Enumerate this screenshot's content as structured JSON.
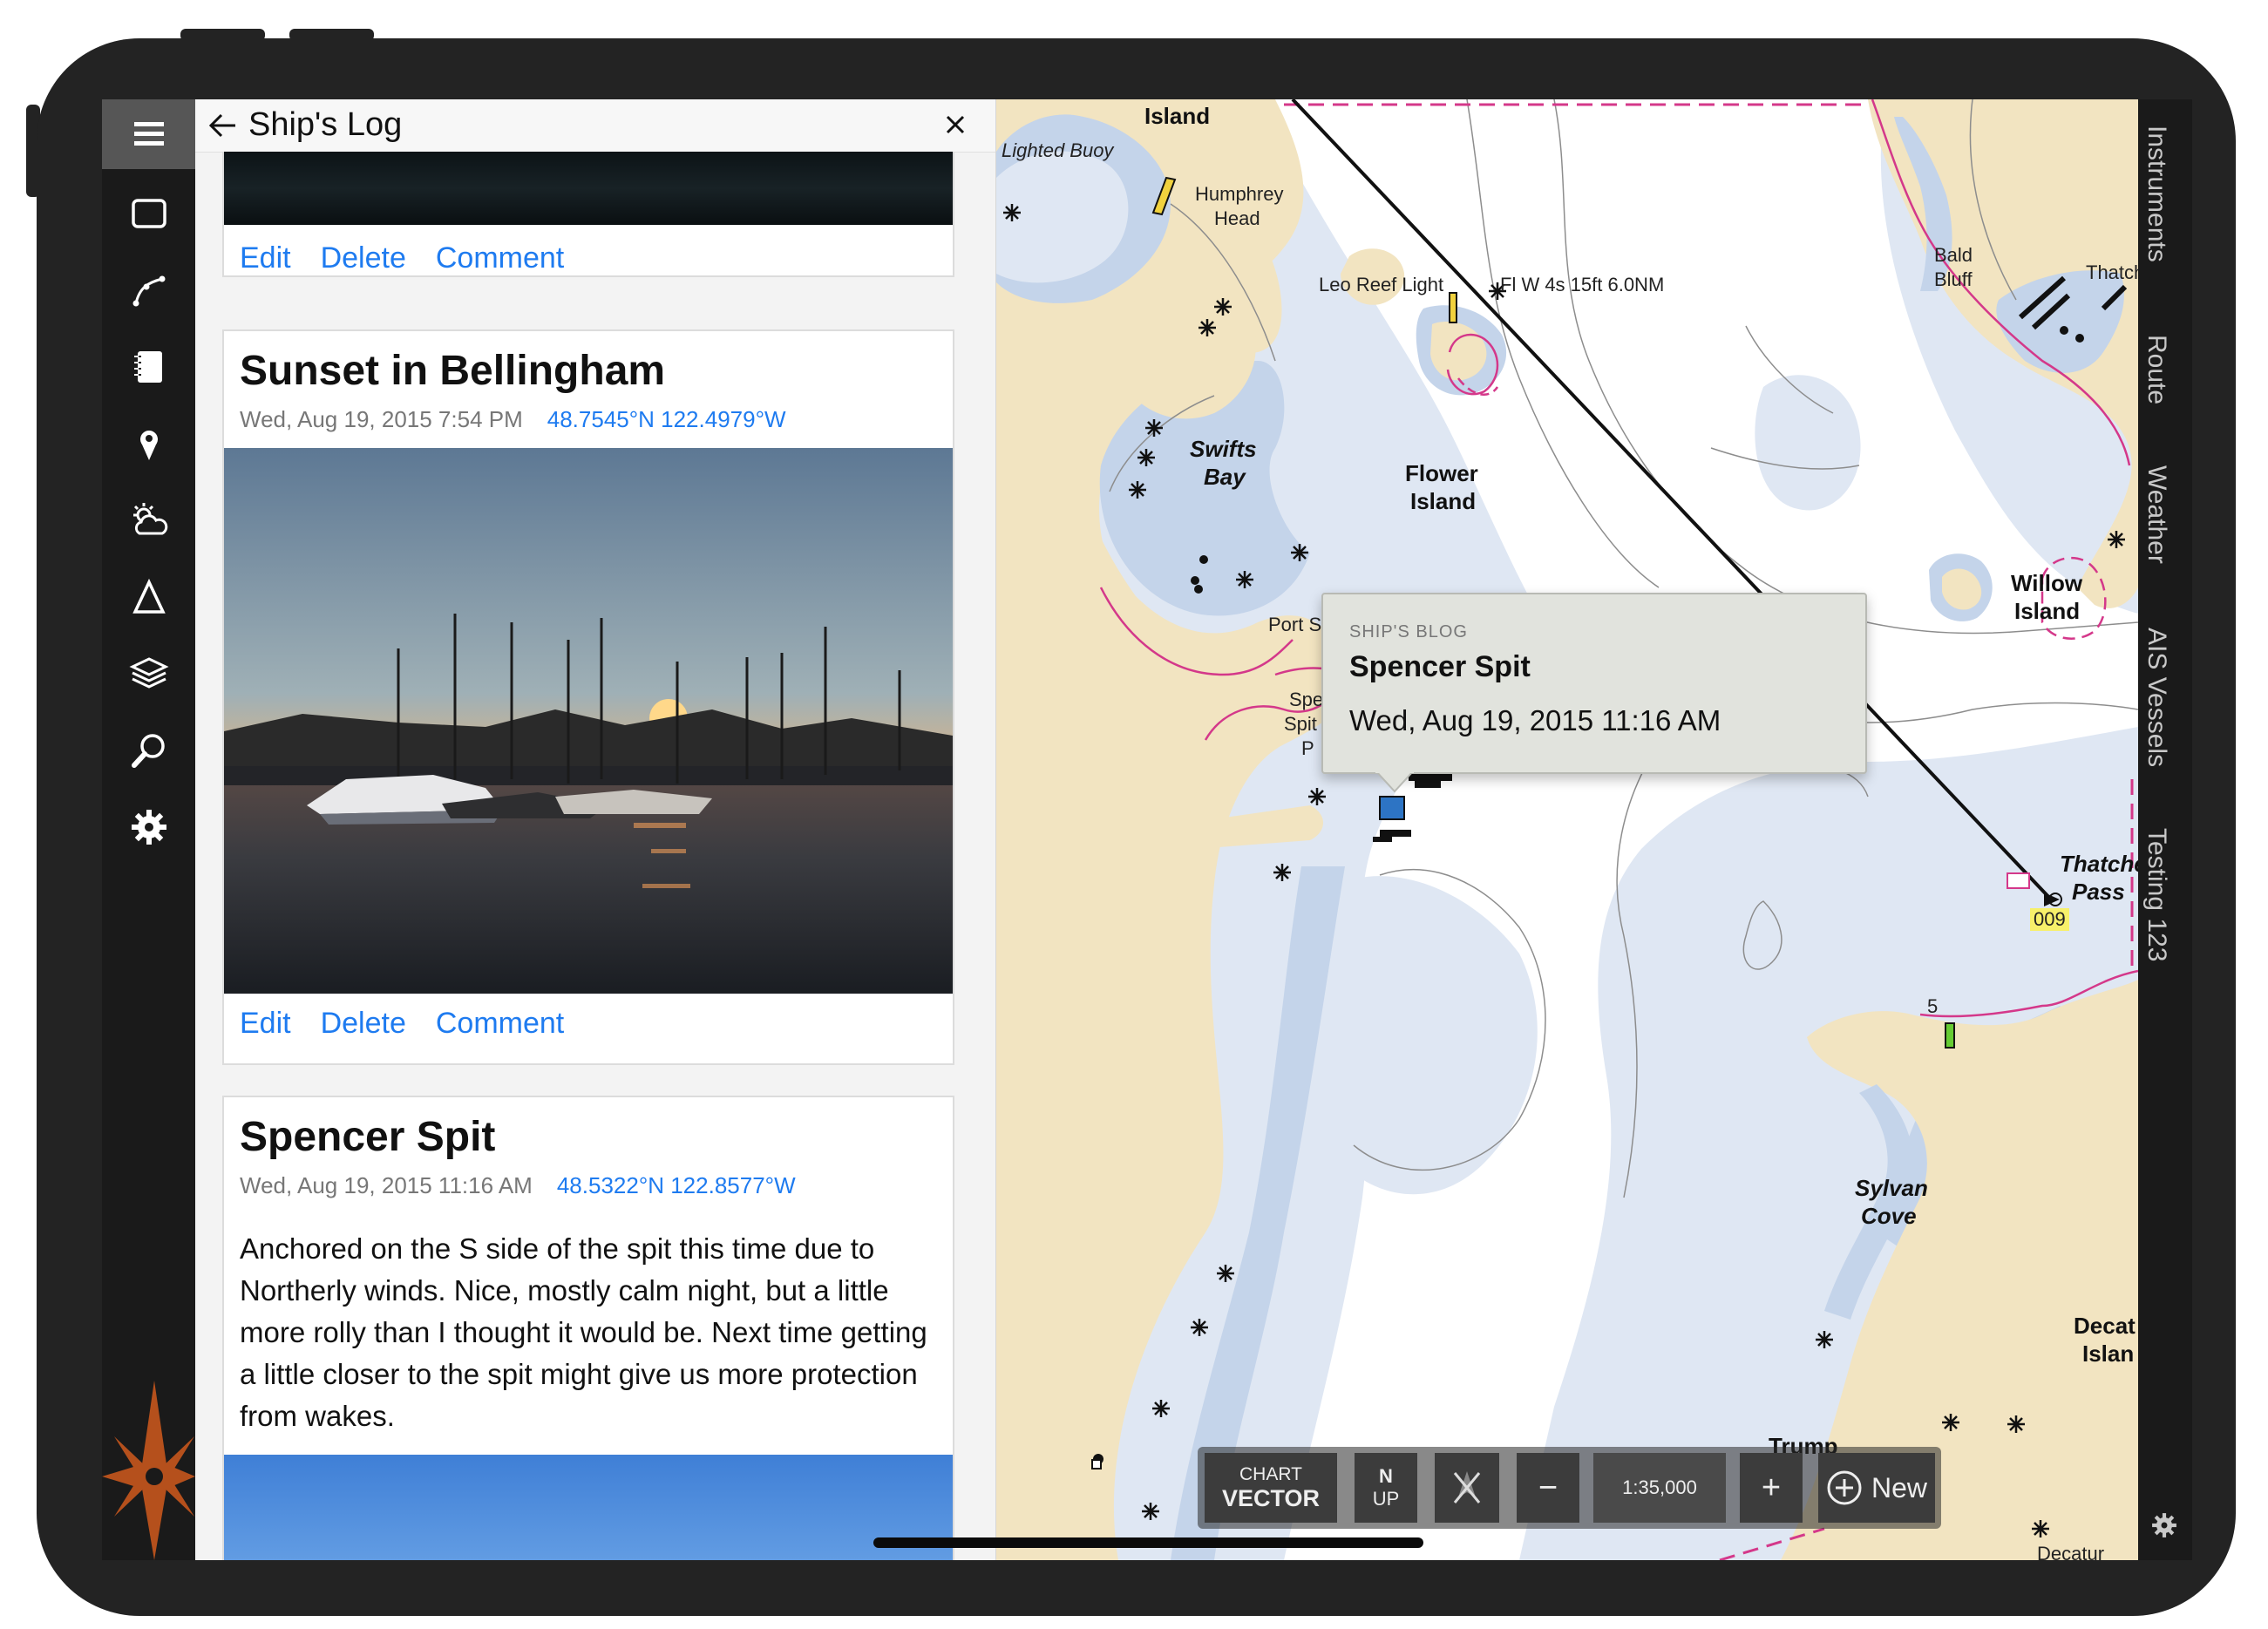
{
  "sidebar": {
    "icons": [
      "menu-icon",
      "chart-frame-icon",
      "route-icon",
      "logbook-icon",
      "marker-pin-icon",
      "weather-icon",
      "triangle-icon",
      "layers-icon",
      "search-icon",
      "gear-icon"
    ]
  },
  "log_panel": {
    "title": "Ship's Log",
    "back_icon": "arrow-left-icon",
    "close_icon": "close-icon",
    "entries": [
      {
        "title": "",
        "date": "",
        "coords": "",
        "actions": {
          "edit": "Edit",
          "delete": "Delete",
          "comment": "Comment"
        }
      },
      {
        "title": "Sunset in Bellingham",
        "date": "Wed, Aug 19, 2015 7:54 PM",
        "coords": "48.7545°N 122.4979°W",
        "actions": {
          "edit": "Edit",
          "delete": "Delete",
          "comment": "Comment"
        }
      },
      {
        "title": "Spencer Spit",
        "date": "Wed, Aug 19, 2015 11:16 AM",
        "coords": "48.5322°N 122.8577°W",
        "text": "Anchored on the S side of the spit this time due to Northerly winds. Nice, mostly calm night, but a little more rolly than I thought it would be. Next time getting a little closer to the spit might give us more protection from wakes."
      }
    ]
  },
  "map": {
    "labels": {
      "island_top": "Island",
      "lighted_buoy": "Lighted Buoy",
      "humphrey_1": "Humphrey",
      "humphrey_2": "Head",
      "leo_reef": "Leo Reef Light",
      "fl_w": "Fl W 4s 15ft 6.0NM",
      "bald_1": "Bald",
      "bald_2": "Bluff",
      "thatch": "Thatch",
      "swifts_1": "Swifts",
      "swifts_2": "Bay",
      "flower_1": "Flower",
      "flower_2": "Island",
      "willow_1": "Willow",
      "willow_2": "Island",
      "port_s": "Port S",
      "spe_1": "Spe",
      "spe_2": "Spit",
      "spe_3": "P",
      "thatcher_1": "Thatcher",
      "thatcher_2": "Pass",
      "buoy_009": "009",
      "depth_5": "5",
      "sylvan_1": "Sylvan",
      "sylvan_2": "Cove",
      "decat_1": "Decat",
      "decat_2": "Islan",
      "trump": "Trump",
      "decatur": "Decatur"
    },
    "popup": {
      "kicker": "SHIP'S BLOG",
      "title": "Spencer Spit",
      "date": "Wed, Aug 19, 2015 11:16 AM"
    },
    "toolbar": {
      "chart_top": "CHART",
      "chart_bottom": "VECTOR",
      "north_top": "N",
      "north_bottom": "UP",
      "zoom_out": "−",
      "scale": "1:35,000",
      "zoom_in": "+",
      "new_label": "New"
    },
    "colors": {
      "land": "#f2e4c1",
      "shallow": "#c4d4ea",
      "mid": "#dfe7f3",
      "deep": "#ffffff",
      "border": "#d4388a",
      "link": "#1e7bf0"
    }
  },
  "right_rail": {
    "tabs": [
      "Instruments",
      "Route",
      "Weather",
      "AIS Vessels",
      "Testing 123"
    ]
  }
}
